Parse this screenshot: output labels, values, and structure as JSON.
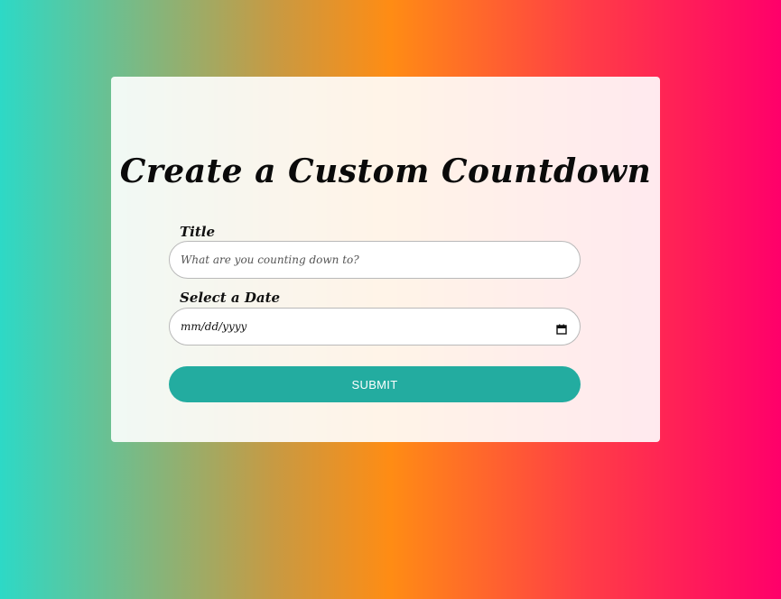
{
  "form": {
    "heading": "Create a Custom Countdown",
    "title_label": "Title",
    "title_placeholder": "What are you counting down to?",
    "title_value": "",
    "date_label": "Select a Date",
    "date_placeholder": "mm/dd/yyyy",
    "submit_label": "SUBMIT"
  },
  "colors": {
    "background_gradient": [
      "#2dd9c6",
      "#c79a43",
      "#ff8c14",
      "#ff3d46",
      "#ff006a"
    ],
    "submit_button": "#23aca0",
    "card": "#ffffff"
  },
  "icons": {
    "date_picker": "calendar-icon"
  }
}
